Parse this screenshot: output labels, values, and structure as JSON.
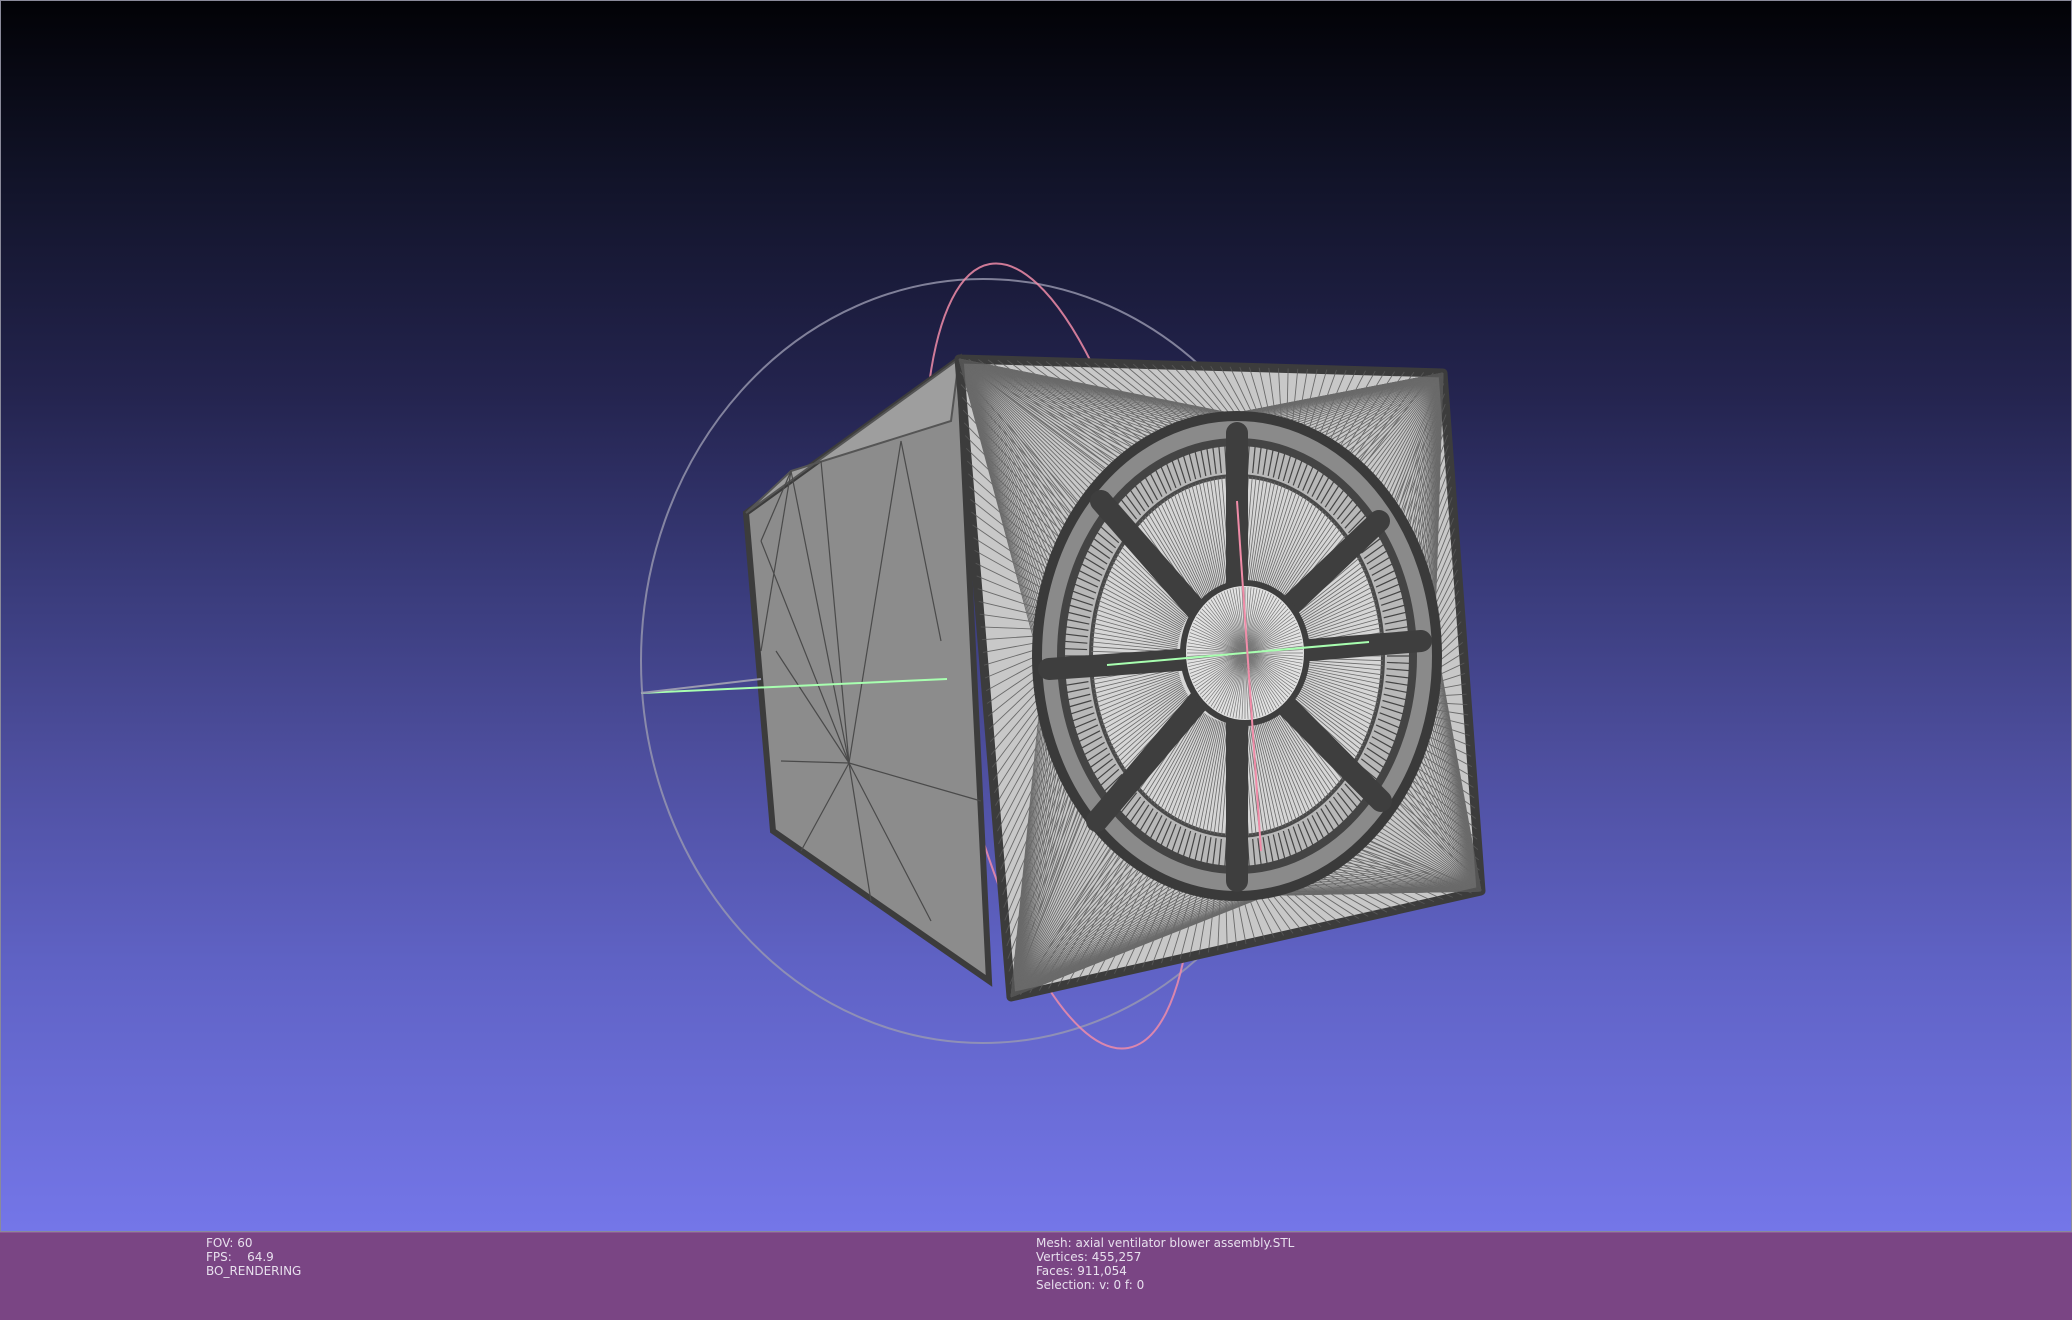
{
  "overlay_left": {
    "fov_label": "FOV:",
    "fov_value": "60",
    "fps_label": "FPS:",
    "fps_value": "64.9",
    "render_mode": "BO_RENDERING"
  },
  "overlay_right": {
    "mesh_label": "Mesh:",
    "mesh_value": "axial ventilator blower assembly.STL",
    "vertices_label": "Vertices:",
    "vertices_value": "455,257",
    "faces_label": "Faces:",
    "faces_value": "911,054",
    "selection_label": "Selection:",
    "selection_value": "v: 0 f: 0"
  },
  "colors": {
    "status_bar": "#7a4584",
    "mesh_face": "#c8c8c8",
    "mesh_edge": "#3c3c3c",
    "trackball_red": "#f08ca8",
    "trackball_green": "#a8ffb0",
    "trackball_gray": "#9a9ab0"
  },
  "icons": {
    "trackball": "trackball-gizmo-icon",
    "mesh": "fan-mesh-render"
  }
}
